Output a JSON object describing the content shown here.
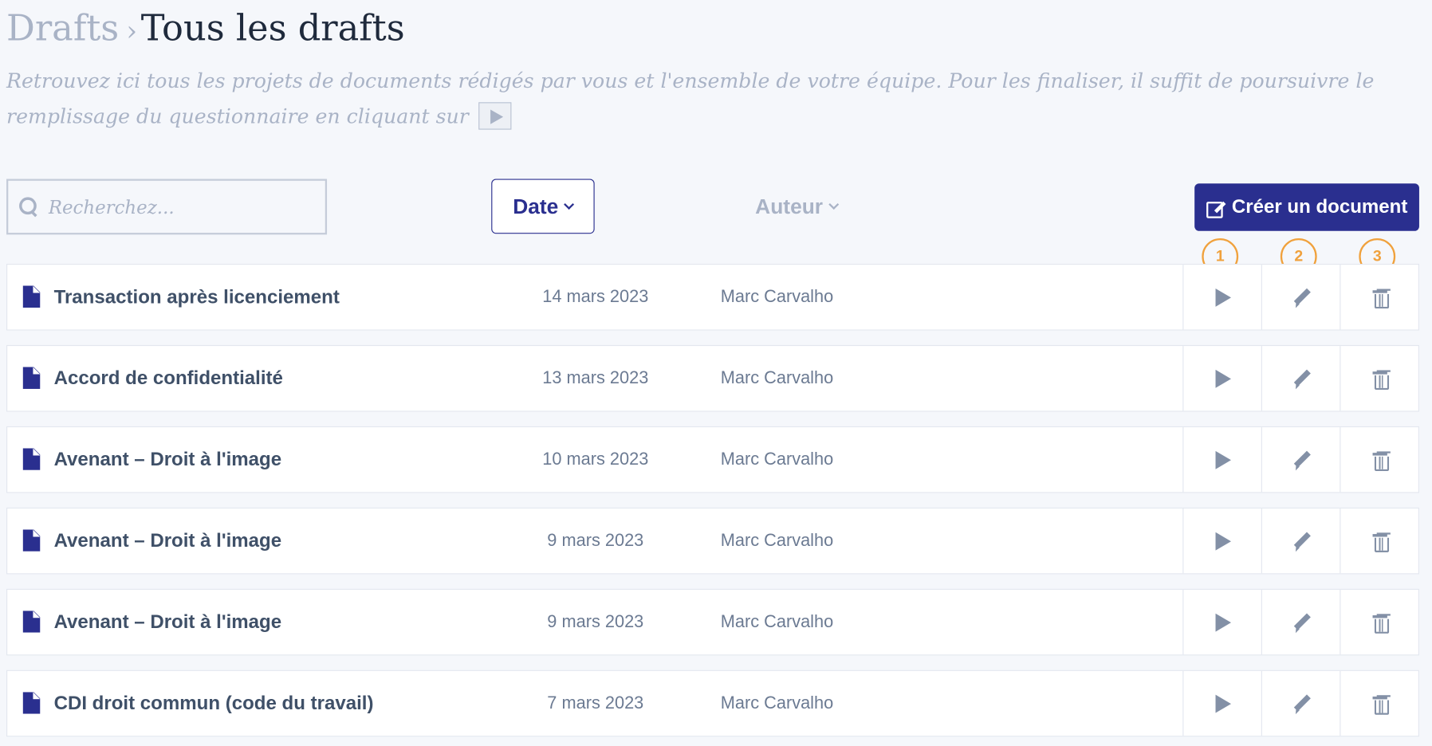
{
  "breadcrumb": {
    "parent": "Drafts",
    "separator": "›",
    "current": "Tous les drafts"
  },
  "intro": {
    "text": "Retrouvez ici tous les projets de documents rédigés par vous et l'ensemble de votre équipe. Pour les finaliser, il suffit de poursuivre le remplissage du questionnaire en cliquant sur"
  },
  "toolbar": {
    "search_placeholder": "Recherchez...",
    "search_value": "",
    "sort_date_label": "Date",
    "sort_author_label": "Auteur",
    "create_label": "Créer un document"
  },
  "badges": [
    "1",
    "2",
    "3"
  ],
  "colors": {
    "accent": "#2a2f8f",
    "badge": "#f0a13c",
    "muted": "#a9b3c6"
  },
  "drafts": [
    {
      "title": "Transaction après licenciement",
      "date": "14 mars 2023",
      "author": "Marc Carvalho"
    },
    {
      "title": "Accord de confidentialité",
      "date": "13 mars 2023",
      "author": "Marc Carvalho"
    },
    {
      "title": "Avenant – Droit à l'image",
      "date": "10 mars 2023",
      "author": "Marc Carvalho"
    },
    {
      "title": "Avenant – Droit à l'image",
      "date": "9 mars 2023",
      "author": "Marc Carvalho"
    },
    {
      "title": "Avenant – Droit à l'image",
      "date": "9 mars 2023",
      "author": "Marc Carvalho"
    },
    {
      "title": "CDI droit commun (code du travail)",
      "date": "7 mars 2023",
      "author": "Marc Carvalho"
    }
  ]
}
